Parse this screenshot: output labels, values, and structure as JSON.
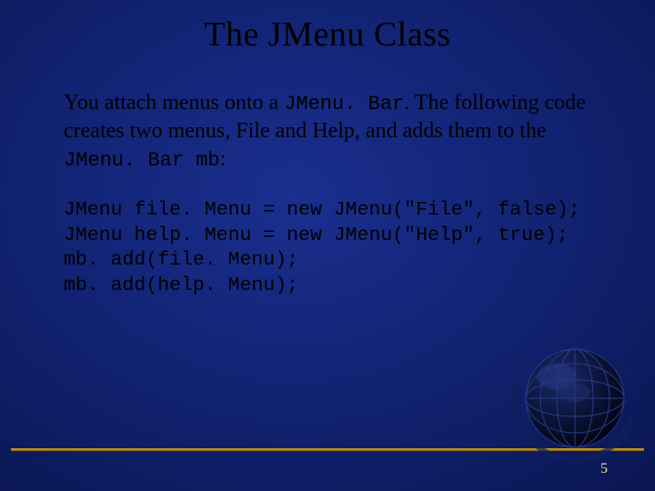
{
  "title": "The JMenu Class",
  "body": {
    "part1": "You attach menus onto a ",
    "mono1": "JMenu. Bar",
    "part2": ". The following code creates two menus, File and Help, and adds them to the ",
    "mono2": "JMenu. Bar mb",
    "part3": ":"
  },
  "code": "JMenu file. Menu = new JMenu(\"File\", false);\nJMenu help. Menu = new JMenu(\"Help\", true);\nmb. add(file. Menu);\nmb. add(help. Menu);",
  "page_number": "5"
}
